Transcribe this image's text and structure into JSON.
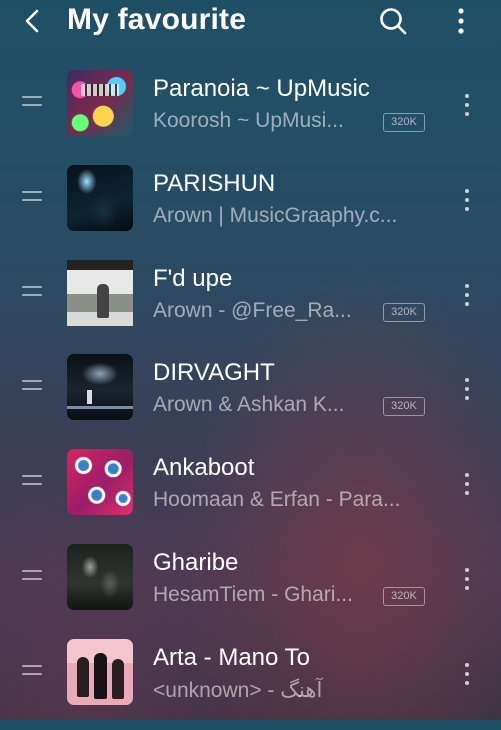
{
  "header": {
    "title": "My favourite",
    "back_icon": "chevron-left-icon",
    "search_icon": "search-icon",
    "more_icon": "more-vertical-icon"
  },
  "songs": [
    {
      "title": "Paranoia ~ UpMusic",
      "subtitle": "Koorosh ~ UpMusi...",
      "quality": "320K"
    },
    {
      "title": "PARISHUN",
      "subtitle": "Arown | MusicGraaphy.c...",
      "quality": ""
    },
    {
      "title": "F'd upe",
      "subtitle": "Arown - @Free_Ra...",
      "quality": "320K"
    },
    {
      "title": "DIRVAGHT",
      "subtitle": "Arown & Ashkan K...",
      "quality": "320K"
    },
    {
      "title": "Ankaboot",
      "subtitle": "Hoomaan & Erfan - Para...",
      "quality": ""
    },
    {
      "title": "Gharibe",
      "subtitle": "HesamTiem - Ghari...",
      "quality": "320K"
    },
    {
      "title": "Arta - Mano To",
      "subtitle": "<unknown> - آهنگ",
      "quality": ""
    }
  ],
  "row_icons": {
    "drag": "drag-handle-icon",
    "more": "more-vertical-icon"
  }
}
